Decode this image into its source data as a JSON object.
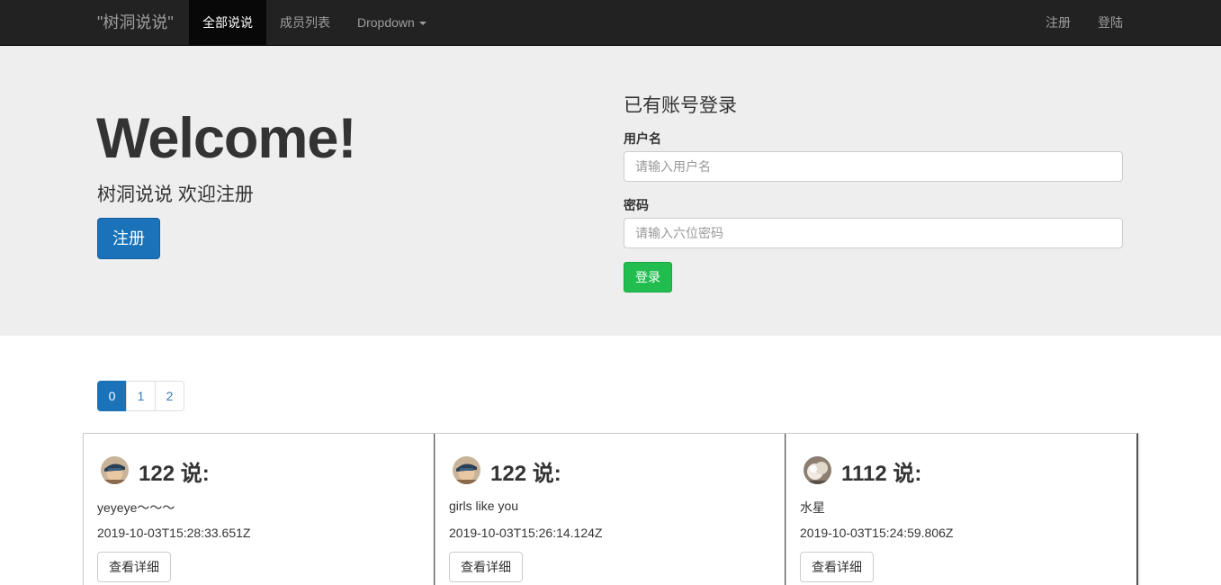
{
  "navbar": {
    "brand": "\"树洞说说\"",
    "items": [
      {
        "label": "全部说说",
        "active": true
      },
      {
        "label": "成员列表",
        "active": false
      },
      {
        "label": "Dropdown",
        "active": false
      }
    ],
    "right_items": [
      {
        "label": "注册"
      },
      {
        "label": "登陆"
      }
    ]
  },
  "jumbotron": {
    "welcome": "Welcome!",
    "subtitle": "树洞说说 欢迎注册",
    "register_button": "注册"
  },
  "login": {
    "title": "已有账号登录",
    "username_label": "用户名",
    "username_placeholder": "请输入用户名",
    "password_label": "密码",
    "password_placeholder": "请输入六位密码",
    "submit": "登录"
  },
  "pagination": {
    "pages": [
      "0",
      "1",
      "2"
    ],
    "active": "0"
  },
  "posts": [
    {
      "title": "122 说:",
      "content": "yeyeye～～～",
      "time": "2019-10-03T15:28:33.651Z",
      "detail": "查看详细",
      "avatar": "avatar-user-122"
    },
    {
      "title": "122 说:",
      "content": "girls like you",
      "time": "2019-10-03T15:26:14.124Z",
      "detail": "查看详细",
      "avatar": "avatar-user-122"
    },
    {
      "title": "1112 说:",
      "content": "水星",
      "time": "2019-10-03T15:24:59.806Z",
      "detail": "查看详细",
      "avatar": "avatar-user-1112"
    }
  ],
  "colors": {
    "navbar_bg": "#222222",
    "primary": "#1a73b8",
    "success": "#22bd4f",
    "jumbotron_bg": "#eeeeee"
  }
}
